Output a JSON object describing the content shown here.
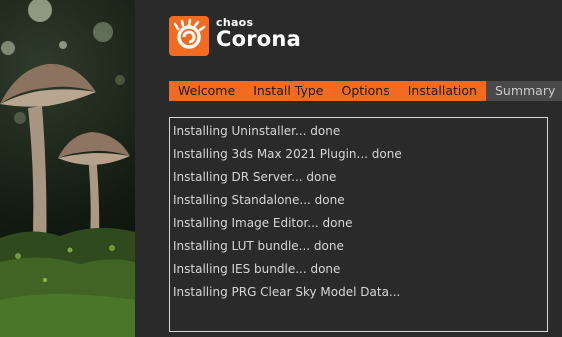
{
  "brand": {
    "company": "chaos",
    "product": "Corona"
  },
  "tabs": [
    {
      "label": "Welcome",
      "state": "done"
    },
    {
      "label": "Install Type",
      "state": "done"
    },
    {
      "label": "Options",
      "state": "done"
    },
    {
      "label": "Installation",
      "state": "active"
    },
    {
      "label": "Summary",
      "state": "pending"
    }
  ],
  "log": [
    "Installing Uninstaller... done",
    "Installing 3ds Max 2021 Plugin... done",
    "Installing DR Server... done",
    "Installing Standalone... done",
    "Installing Image Editor... done",
    "Installing LUT bundle... done",
    "Installing IES bundle... done",
    "Installing PRG Clear Sky Model Data..."
  ],
  "colors": {
    "accent": "#f26b21",
    "inactive_tab": "#4a4a4a",
    "background": "#2a2a2a",
    "text": "#d6d6d6"
  },
  "icons": {
    "logo": "corona-swirl-logo-icon",
    "side_image": "mushroom-photo"
  }
}
